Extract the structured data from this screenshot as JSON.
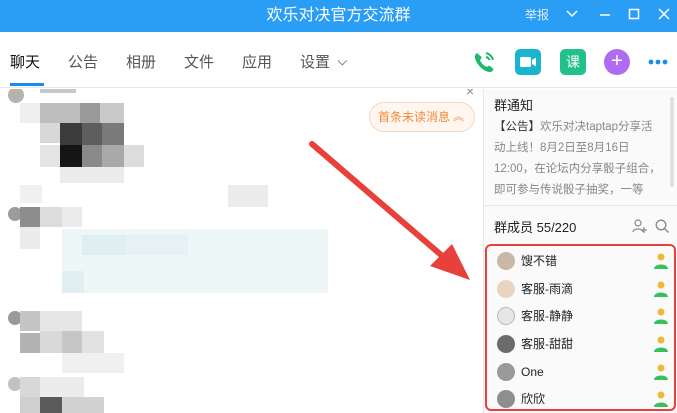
{
  "window": {
    "title": "欢乐对决官方交流群",
    "report_label": "举报"
  },
  "tabs": [
    {
      "label": "聊天",
      "active": true
    },
    {
      "label": "公告",
      "active": false
    },
    {
      "label": "相册",
      "active": false
    },
    {
      "label": "文件",
      "active": false
    },
    {
      "label": "应用",
      "active": false
    },
    {
      "label": "设置",
      "active": false
    }
  ],
  "toolbar_icons": [
    "phone-icon",
    "video-icon",
    "lesson-icon",
    "plus-icon",
    "more-icon"
  ],
  "chat": {
    "unread_label": "首条未读消息"
  },
  "notice": {
    "title": "群通知",
    "tag": "【公告】",
    "text": "欢乐对决taptap分享活动上线！8月2日至8月16日12:00，在论坛内分享骰子组合，即可参与传说骰子抽奖，一等奖…"
  },
  "members": {
    "title": "群成员 55/220",
    "list": [
      {
        "name": "馊不错"
      },
      {
        "name": "客服-雨滴"
      },
      {
        "name": "客服-静静"
      },
      {
        "name": "客服-甜甜"
      },
      {
        "name": "One"
      },
      {
        "name": "欣欣"
      }
    ]
  },
  "colors": {
    "title_bar": "#2a9df4",
    "accent": "#1a8cf0",
    "highlight_border": "#e8403a",
    "arrow": "#e8403a"
  }
}
